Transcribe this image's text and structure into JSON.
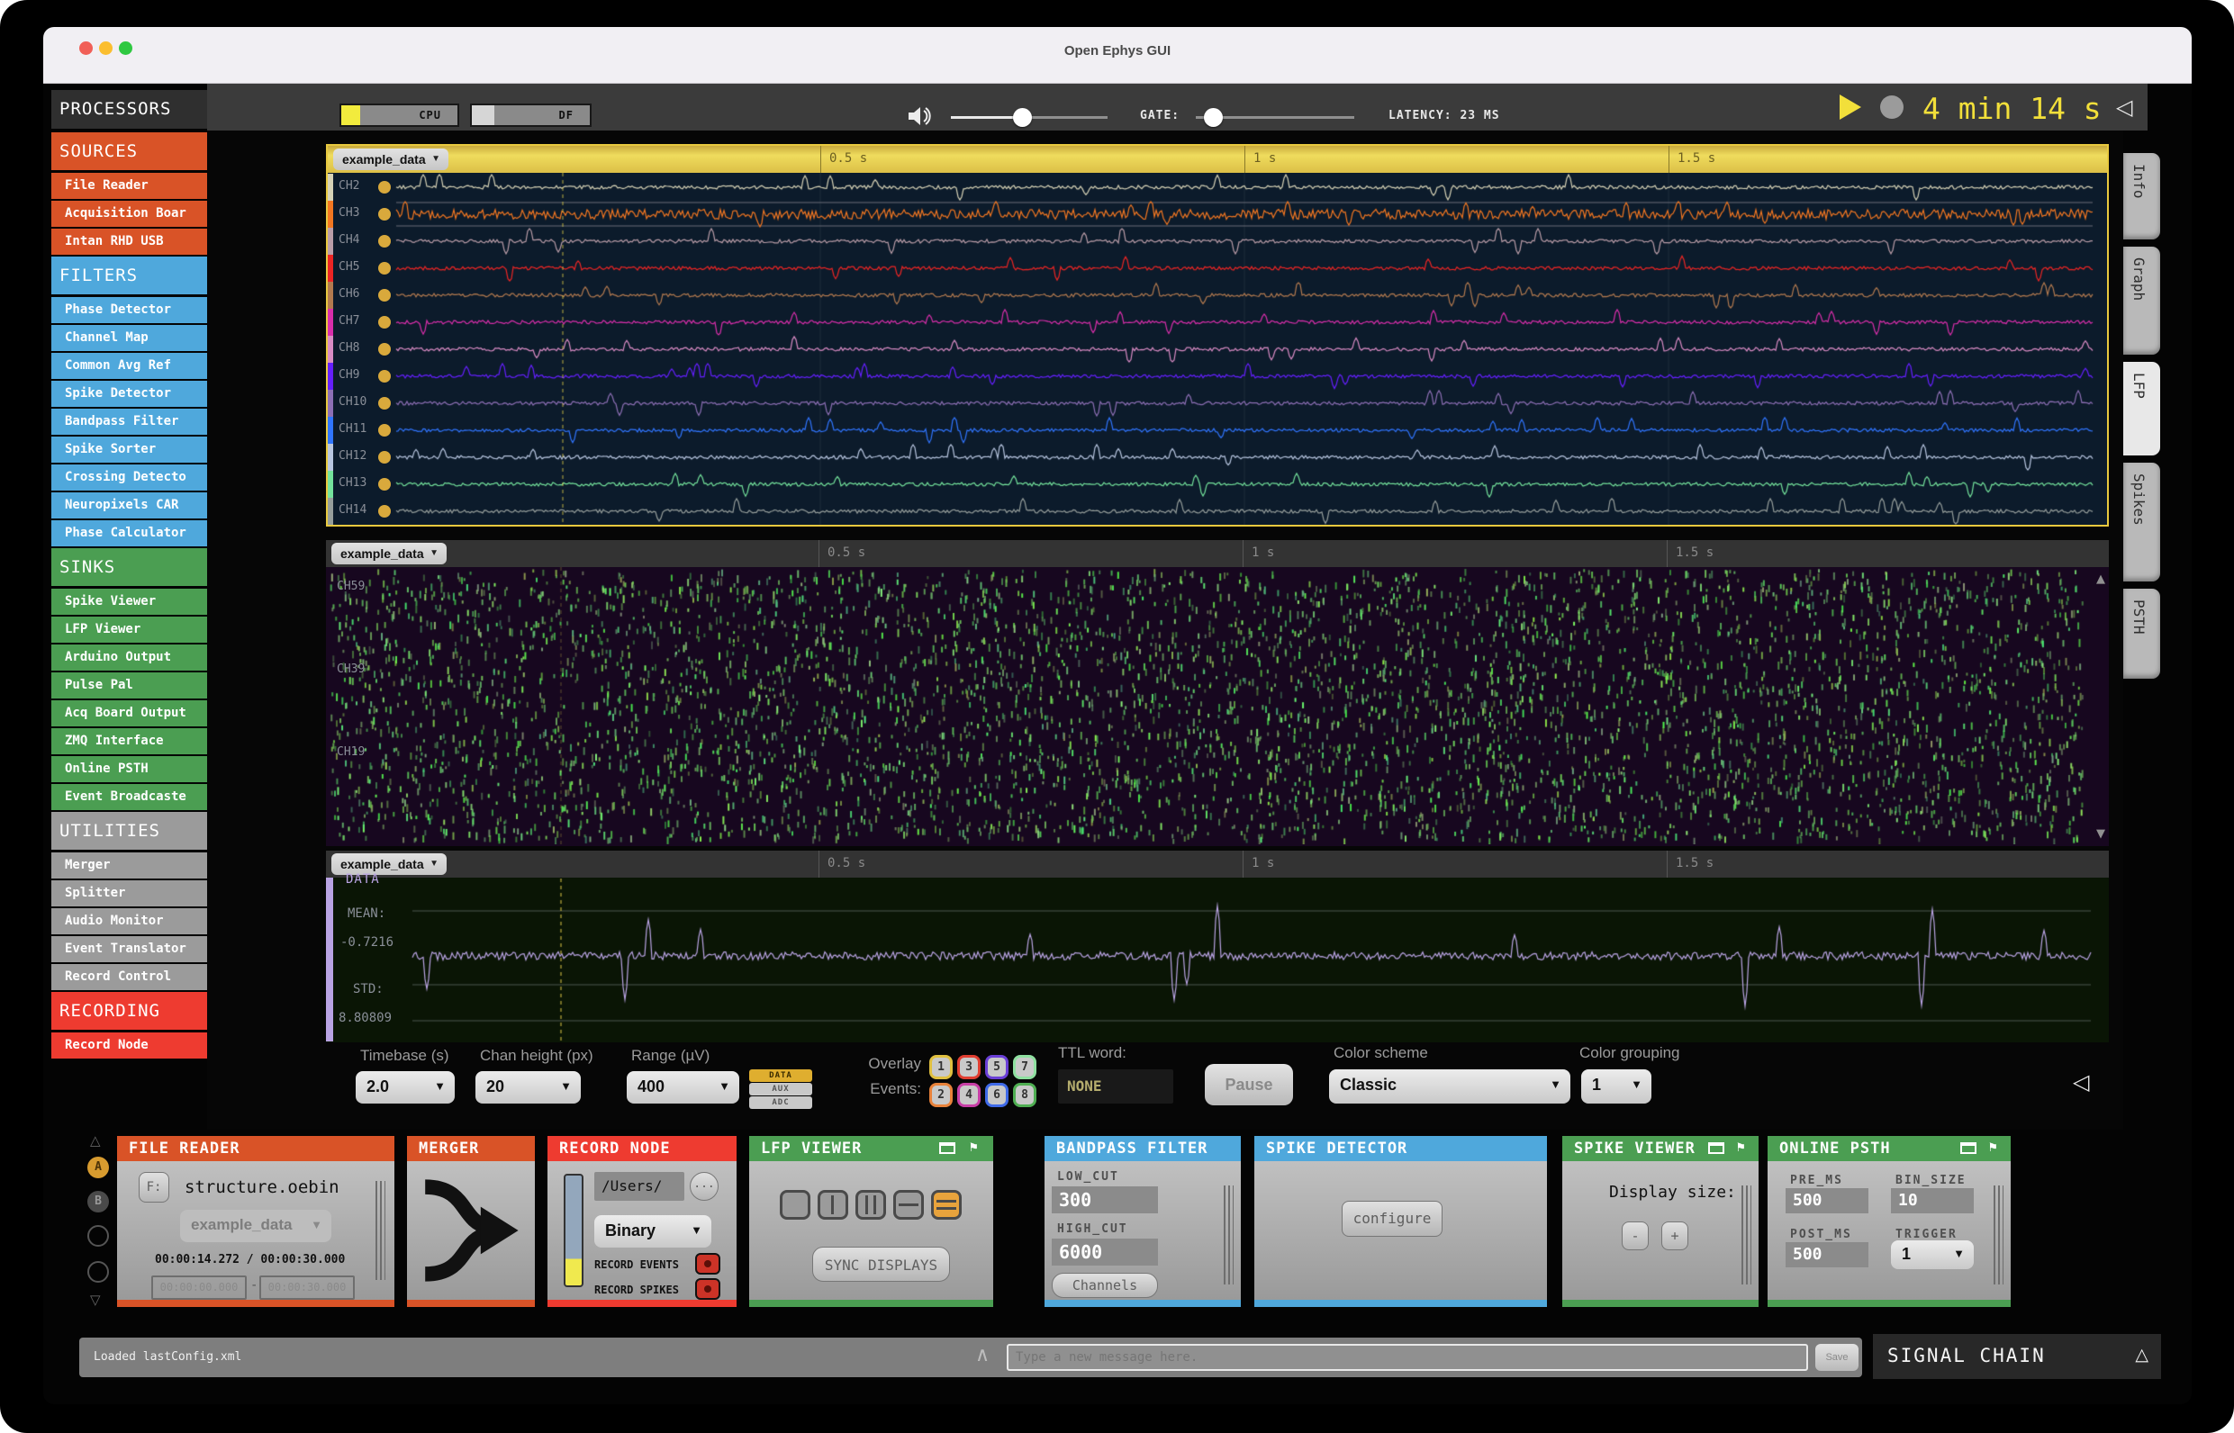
{
  "window": {
    "title": "Open Ephys GUI"
  },
  "topbar": {
    "cpu": {
      "label": "CPU",
      "fill_pct": 16,
      "fill_color": "#F2EB3D"
    },
    "df": {
      "label": "DF",
      "fill_pct": 19,
      "fill_color": "#D6D6D6"
    },
    "volume_pct": 45,
    "gate": {
      "label": "GATE:",
      "value_pct": 10
    },
    "latency": "LATENCY: 23 MS",
    "timer": "4 min 14 s"
  },
  "sidebar": {
    "title": "PROCESSORS",
    "sections": [
      {
        "label": "SOURCES",
        "color": "#D95327",
        "items": [
          "File Reader",
          "Acquisition Boar",
          "Intan RHD USB"
        ]
      },
      {
        "label": "FILTERS",
        "color": "#4FA8DC",
        "items": [
          "Phase Detector",
          "Channel Map",
          "Common Avg Ref",
          "Spike Detector",
          "Bandpass Filter",
          "Spike Sorter",
          "Crossing Detecto",
          "Neuropixels CAR",
          "Phase Calculator"
        ]
      },
      {
        "label": "SINKS",
        "color": "#4B9E52",
        "items": [
          "Spike Viewer",
          "LFP Viewer",
          "Arduino Output",
          "Pulse Pal",
          "Acq Board Output",
          "ZMQ Interface",
          "Online PSTH",
          "Event Broadcaste"
        ]
      },
      {
        "label": "UTILITIES",
        "color": "#9B9B9B",
        "items": [
          "Merger",
          "Splitter",
          "Audio Monitor",
          "Event Translator",
          "Record Control"
        ]
      },
      {
        "label": "RECORDING",
        "color": "#EE3B30",
        "items": [
          "Record Node"
        ]
      }
    ]
  },
  "viewer": {
    "time_ticks": [
      "0.5 s",
      "1 s",
      "1.5 s"
    ],
    "panel1": {
      "source": "example_data",
      "channels": [
        {
          "name": "CH2",
          "color": "#D6D2B6"
        },
        {
          "name": "CH3",
          "color": "#F37721"
        },
        {
          "name": "CH4",
          "color": "#BA9DA8"
        },
        {
          "name": "CH5",
          "color": "#ED2524"
        },
        {
          "name": "CH6",
          "color": "#B37A4F"
        },
        {
          "name": "CH7",
          "color": "#D92EAB"
        },
        {
          "name": "CH8",
          "color": "#D98BC4"
        },
        {
          "name": "CH9",
          "color": "#651FFF"
        },
        {
          "name": "CH10",
          "color": "#8D6FB5"
        },
        {
          "name": "CH11",
          "color": "#3075FF"
        },
        {
          "name": "CH12",
          "color": "#B8C6E0"
        },
        {
          "name": "CH13",
          "color": "#74E39C"
        },
        {
          "name": "CH14",
          "color": "#969E9B"
        }
      ]
    },
    "panel2": {
      "source": "example_data",
      "channel_labels": [
        "CH59",
        "CH39",
        "CH19"
      ],
      "tick_color": "#8ED67E"
    },
    "panel3": {
      "source": "example_data",
      "data_label": "DATA",
      "mean_label": "MEAN:",
      "mean_value": "-0.7216",
      "std_label": "STD:",
      "std_value": "8.80809",
      "trace_color": "#B9A3E3"
    },
    "tabs": [
      {
        "label": "Info",
        "active": false
      },
      {
        "label": "Graph",
        "active": false
      },
      {
        "label": "LFP",
        "active": true
      },
      {
        "label": "Spikes",
        "active": false
      },
      {
        "label": "PSTH",
        "active": false
      }
    ]
  },
  "options": {
    "timebase_label": "Timebase (s)",
    "timebase_value": "2.0",
    "chan_height_label": "Chan height (px)",
    "chan_height_value": "20",
    "range_label": "Range (µV)",
    "range_value": "400",
    "channel_types": [
      {
        "label": "DATA",
        "selected": true,
        "color": "#DFAE2F"
      },
      {
        "label": "AUX",
        "selected": false,
        "color": "#C9C9C9"
      },
      {
        "label": "ADC",
        "selected": false,
        "color": "#C9C9C9"
      }
    ],
    "overlay_line1": "Overlay",
    "overlay_line2": "Events:",
    "event_buttons": [
      {
        "n": "1",
        "color": "#E0C040"
      },
      {
        "n": "2",
        "color": "#E8823A"
      },
      {
        "n": "3",
        "color": "#E03E31"
      },
      {
        "n": "4",
        "color": "#C73FA6"
      },
      {
        "n": "5",
        "color": "#6A3FD6"
      },
      {
        "n": "6",
        "color": "#3F6AE8"
      },
      {
        "n": "7",
        "color": "#8FE0A0"
      },
      {
        "n": "8",
        "color": "#4FAE52"
      }
    ],
    "ttl_label": "TTL word:",
    "ttl_value": "NONE",
    "pause_label": "Pause",
    "color_scheme_label": "Color scheme",
    "color_scheme_value": "Classic",
    "color_grouping_label": "Color grouping",
    "color_grouping_value": "1"
  },
  "chain": {
    "selector_tabs": [
      {
        "label": "A",
        "active": true
      },
      {
        "label": "B",
        "active": false
      }
    ],
    "file_reader": {
      "title": "FILE READER",
      "color": "#D95327",
      "f_label": "F:",
      "filename": "structure.oebin",
      "source": "example_data",
      "progress": "00:00:14.272 / 00:00:30.000",
      "start": "00:00:00.000",
      "separator": "-",
      "end": "00:00:30.000"
    },
    "merger": {
      "title": "MERGER",
      "color": "#D95327"
    },
    "record_node": {
      "title": "RECORD NODE",
      "color": "#EE3B30",
      "path": "/Users/",
      "browse": "...",
      "engine": "Binary",
      "events_label": "RECORD EVENTS",
      "spikes_label": "RECORD SPIKES"
    },
    "lfp_viewer": {
      "title": "LFP VIEWER",
      "color": "#4B9E52",
      "sync_label": "SYNC DISPLAYS",
      "selected_layout": 4,
      "layout_accent": "#E8A33C"
    },
    "bandpass": {
      "title": "BANDPASS FILTER",
      "color": "#4FA8DC",
      "low_label": "LOW_CUT",
      "low_value": "300",
      "high_label": "HIGH_CUT",
      "high_value": "6000",
      "channels_label": "Channels"
    },
    "spike_detector": {
      "title": "SPIKE DETECTOR",
      "color": "#4FA8DC",
      "configure_label": "configure"
    },
    "spike_viewer": {
      "title": "SPIKE VIEWER",
      "color": "#4B9E52",
      "display_label": "Display size:",
      "minus": "-",
      "plus": "+"
    },
    "online_psth": {
      "title": "ONLINE PSTH",
      "color": "#4B9E52",
      "pre_label": "PRE_MS",
      "pre_value": "500",
      "bin_label": "BIN_SIZE",
      "bin_value": "10",
      "post_label": "POST_MS",
      "post_value": "500",
      "trigger_label": "TRIGGER",
      "trigger_value": "1"
    }
  },
  "statusbar": {
    "status": "Loaded lastConfig.xml",
    "placeholder": "Type a new message here.",
    "save_label": "Save",
    "signal_chain_label": "SIGNAL CHAIN"
  }
}
